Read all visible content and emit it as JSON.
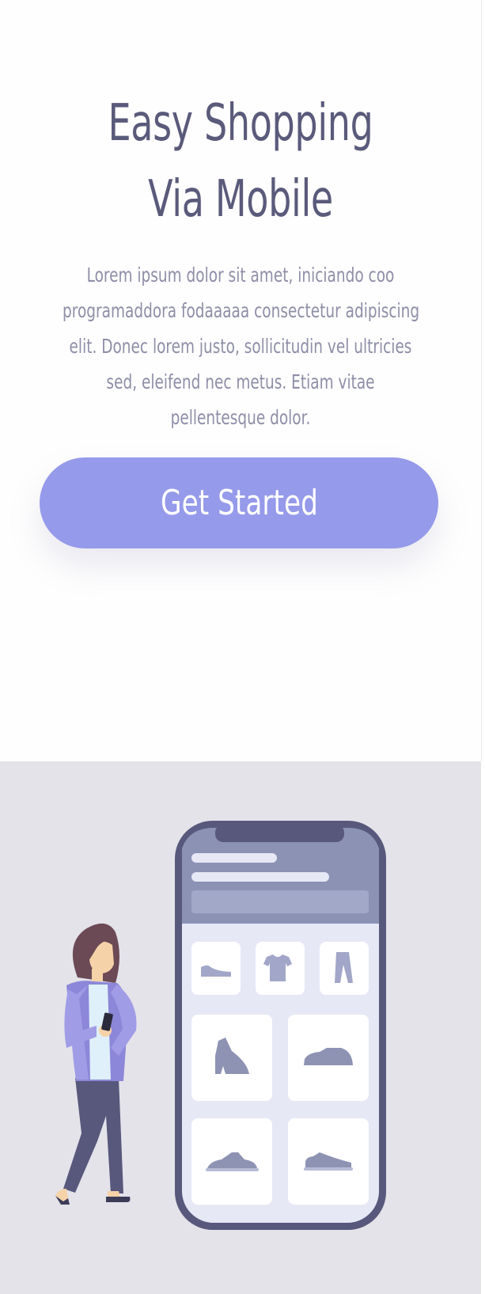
{
  "hero": {
    "title_line1": "Easy Shopping",
    "title_line2": "Via Mobile",
    "description_lines": [
      "Lorem ipsum dolor sit amet, iniciando coo",
      "programaddora fodaaaaa consectetur adipiscing",
      "elit. Donec lorem justo, sollicitudin vel ultricies",
      "sed, eleifend nec metus. Etiam vitae",
      "pellentesque dolor."
    ],
    "cta_label": "Get Started"
  },
  "illustration": {
    "icons": [
      "flat-shoe-icon",
      "tshirt-icon",
      "pants-icon",
      "ankle-boot-icon",
      "sneaker-icon",
      "low-sneaker-icon",
      "slip-on-shoe-icon"
    ]
  },
  "colors": {
    "heading": "#5a5a7b",
    "body_text": "#8e8ea8",
    "button": "#959aea",
    "illustration_bg": "#e4e3ea",
    "phone_frame": "#58587c"
  }
}
